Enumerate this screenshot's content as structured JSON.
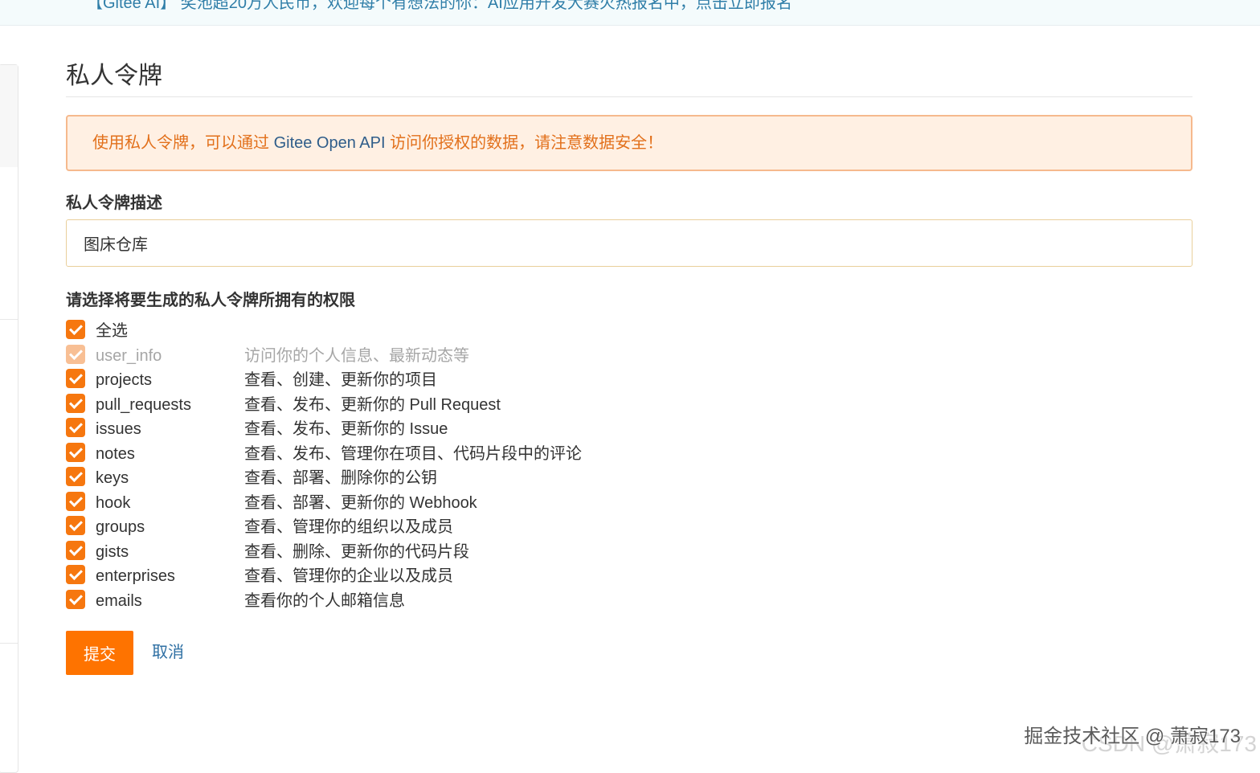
{
  "banner": {
    "text": "【Gitee AI】 奖池超20万人民币，欢迎每个有想法的你：AI应用开发大赛火热报名中，点击立即报名"
  },
  "page": {
    "title": "私人令牌"
  },
  "notice": {
    "prefix": "使用私人令牌，可以通过 ",
    "api": "Gitee Open API",
    "suffix": " 访问你授权的数据，请注意数据安全！"
  },
  "description_field": {
    "label": "私人令牌描述",
    "value": "图床仓库"
  },
  "permissions": {
    "label": "请选择将要生成的私人令牌所拥有的权限",
    "select_all": "全选",
    "items": [
      {
        "name": "user_info",
        "desc": "访问你的个人信息、最新动态等",
        "checked": true,
        "disabled": true
      },
      {
        "name": "projects",
        "desc": "查看、创建、更新你的项目",
        "checked": true,
        "disabled": false
      },
      {
        "name": "pull_requests",
        "desc": "查看、发布、更新你的 Pull Request",
        "checked": true,
        "disabled": false
      },
      {
        "name": "issues",
        "desc": "查看、发布、更新你的 Issue",
        "checked": true,
        "disabled": false
      },
      {
        "name": "notes",
        "desc": "查看、发布、管理你在项目、代码片段中的评论",
        "checked": true,
        "disabled": false
      },
      {
        "name": "keys",
        "desc": "查看、部署、删除你的公钥",
        "checked": true,
        "disabled": false
      },
      {
        "name": "hook",
        "desc": "查看、部署、更新你的 Webhook",
        "checked": true,
        "disabled": false
      },
      {
        "name": "groups",
        "desc": "查看、管理你的组织以及成员",
        "checked": true,
        "disabled": false
      },
      {
        "name": "gists",
        "desc": "查看、删除、更新你的代码片段",
        "checked": true,
        "disabled": false
      },
      {
        "name": "enterprises",
        "desc": "查看、管理你的企业以及成员",
        "checked": true,
        "disabled": false
      },
      {
        "name": "emails",
        "desc": "查看你的个人邮箱信息",
        "checked": true,
        "disabled": false
      }
    ]
  },
  "actions": {
    "submit_label": "提交",
    "cancel_label": "取消"
  },
  "watermark": {
    "text": "掘金技术社区 @ 萧寂173",
    "ghost": "CSDN @萧寂173"
  },
  "colors": {
    "accent": "#fe7300",
    "checkbox": "#f6770f",
    "notice_bg": "#fff0e3",
    "notice_text": "#e2701b",
    "link": "#2e6fa3"
  }
}
